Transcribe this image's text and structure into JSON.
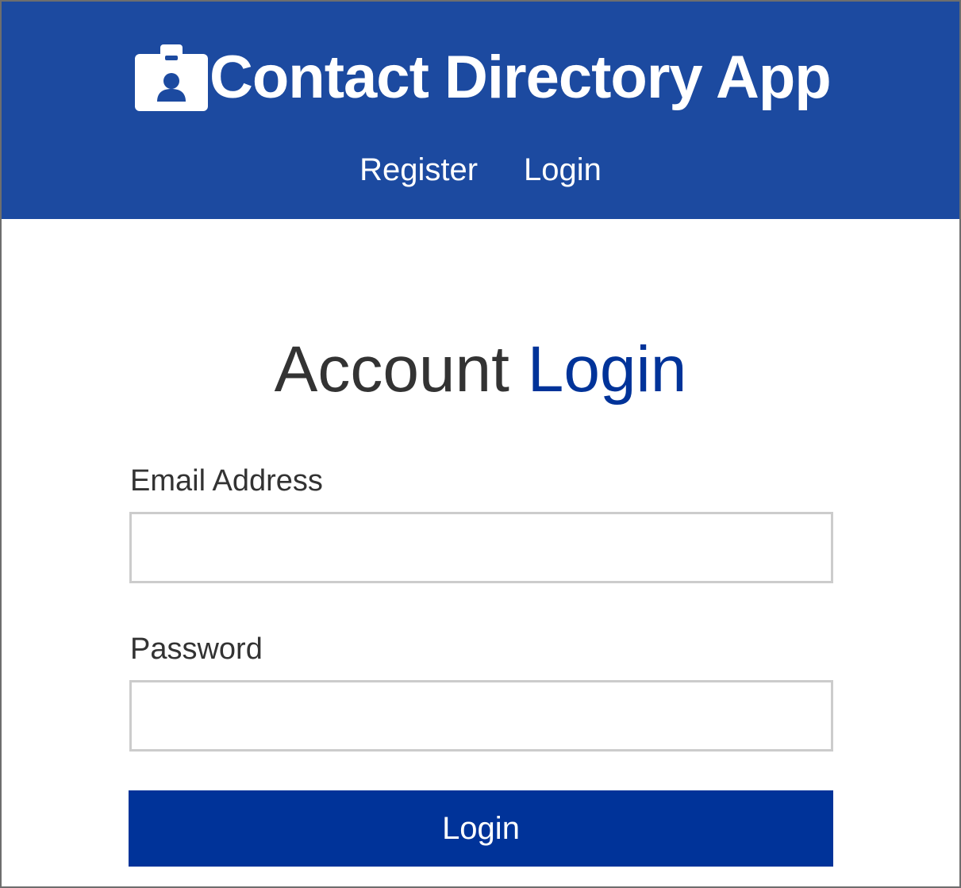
{
  "navbar": {
    "brand_icon": "id-badge-icon",
    "title": "Contact Directory App",
    "links": [
      {
        "label": "Register"
      },
      {
        "label": "Login"
      }
    ],
    "background_color": "#1c4aa0"
  },
  "form": {
    "heading_prefix": "Account",
    "heading_accent": "Login",
    "email_label": "Email Address",
    "email_value": "",
    "password_label": "Password",
    "password_value": "",
    "submit_label": "Login",
    "accent_color": "#003399"
  }
}
